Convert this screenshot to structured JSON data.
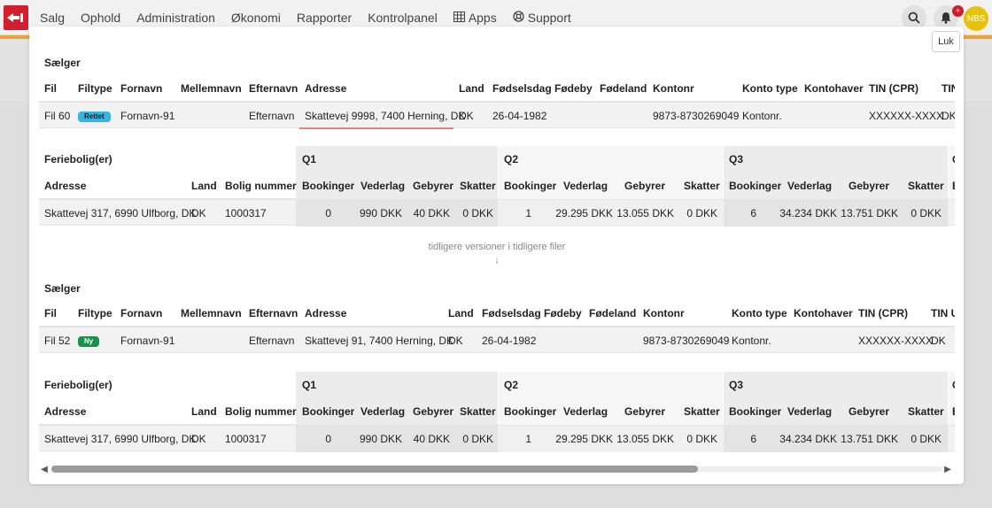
{
  "nav": {
    "items": [
      "Salg",
      "Ophold",
      "Administration",
      "Økonomi",
      "Rapporter",
      "Kontrolpanel"
    ],
    "apps": "Apps",
    "support": "Support"
  },
  "notifications": {
    "badge": "+"
  },
  "user": {
    "initials": "NBS"
  },
  "modal": {
    "close_label": "Luk"
  },
  "tables": {
    "seller_title": "Sælger",
    "holiday_title": "Feriebolig(er)",
    "seller_headers": [
      "Fil",
      "Filtype",
      "Fornavn",
      "Mellemnavn",
      "Efternavn",
      "Adresse",
      "Land",
      "Fødselsdag",
      "Fødeby",
      "Fødeland",
      "Kontonr",
      "Konto type",
      "Kontohaver",
      "TIN (CPR)",
      "TIN"
    ],
    "seller_headers_2_last": "TIN U",
    "holiday_headers": [
      "Adresse",
      "Land",
      "Bolig nummer"
    ],
    "quarters": [
      "Q1",
      "Q2",
      "Q3",
      "Q"
    ],
    "quarter_cols": [
      "Bookinger",
      "Vederlag",
      "Gebyrer",
      "Skatter"
    ],
    "q4_partial": "B"
  },
  "current": {
    "seller": {
      "fil": "Fil 60",
      "filtype": "Rettet",
      "fornavn": "Fornavn-91",
      "mellemnavn": "",
      "efternavn": "Efternavn",
      "adresse": "Skattevej 9998, 7400 Herning, DK",
      "land": "DK",
      "foedselsdag": "26-04-1982",
      "foedeby": "",
      "foedeland": "",
      "kontonr": "9873-8730269049",
      "konto_type": "Kontonr.",
      "kontohaver": "",
      "tin": "XXXXXX-XXXX",
      "tin2": "DK"
    },
    "holiday": {
      "adresse": "Skattevej 317, 6990 Ulfborg, DK",
      "land": "DK",
      "bolig": "1000317",
      "q": [
        [
          "0",
          "990 DKK",
          "40 DKK",
          "0 DKK"
        ],
        [
          "1",
          "29.295 DKK",
          "13.055 DKK",
          "0 DKK"
        ],
        [
          "6",
          "34.234 DKK",
          "13.751 DKK",
          "0 DKK"
        ]
      ]
    }
  },
  "divider": {
    "text": "tidligere versioner i tidligere filer",
    "arrow": "↓"
  },
  "previous": {
    "seller": {
      "fil": "Fil 52",
      "filtype": "Ny",
      "fornavn": "Fornavn-91",
      "mellemnavn": "",
      "efternavn": "Efternavn",
      "adresse": "Skattevej 91, 7400 Herning, DK",
      "land": "DK",
      "foedselsdag": "26-04-1982",
      "foedeby": "",
      "foedeland": "",
      "kontonr": "9873-8730269049",
      "konto_type": "Kontonr.",
      "kontohaver": "",
      "tin": "XXXXXX-XXXX",
      "tin2": "DK"
    },
    "holiday": {
      "adresse": "Skattevej 317, 6990 Ulfborg, DK",
      "land": "DK",
      "bolig": "1000317",
      "q": [
        [
          "0",
          "990 DKK",
          "40 DKK",
          "0 DKK"
        ],
        [
          "1",
          "29.295 DKK",
          "13.055 DKK",
          "0 DKK"
        ],
        [
          "6",
          "34.234 DKK",
          "13.751 DKK",
          "0 DKK"
        ]
      ]
    }
  },
  "colors": {
    "brand": "#d21f2f",
    "accent": "#e8a33a",
    "rettet": "#38b4e3",
    "ny": "#1b8f4e",
    "avatar": "#e6c20e"
  }
}
